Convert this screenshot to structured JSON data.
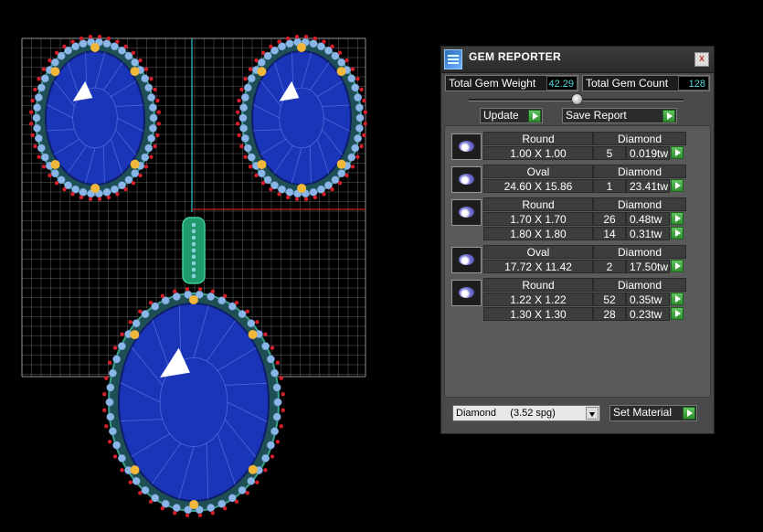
{
  "viewport": {
    "background": "#000000",
    "grid_color": "#b0b0b0",
    "gem_color": "#1a35b8",
    "prong_colors": [
      "#d21f2a",
      "#f1b73a",
      "#8bb6e8"
    ]
  },
  "panel": {
    "title": "GEM REPORTER",
    "close_label": "x",
    "total_weight_label": "Total Gem Weight",
    "total_weight_value": "42.29",
    "total_count_label": "Total Gem Count",
    "total_count_value": "128",
    "update_label": "Update",
    "save_report_label": "Save Report",
    "groups": [
      {
        "shape": "Round",
        "material": "Diamond",
        "rows": [
          {
            "size": "1.00 X 1.00",
            "count": "5",
            "weight": "0.019tw"
          }
        ]
      },
      {
        "shape": "Oval",
        "material": "Diamond",
        "rows": [
          {
            "size": "24.60 X 15.86",
            "count": "1",
            "weight": "23.41tw"
          }
        ]
      },
      {
        "shape": "Round",
        "material": "Diamond",
        "rows": [
          {
            "size": "1.70 X 1.70",
            "count": "26",
            "weight": "0.48tw"
          },
          {
            "size": "1.80 X 1.80",
            "count": "14",
            "weight": "0.31tw"
          }
        ]
      },
      {
        "shape": "Oval",
        "material": "Diamond",
        "rows": [
          {
            "size": "17.72 X 11.42",
            "count": "2",
            "weight": "17.50tw"
          }
        ]
      },
      {
        "shape": "Round",
        "material": "Diamond",
        "rows": [
          {
            "size": "1.22 X 1.22",
            "count": "52",
            "weight": "0.35tw"
          },
          {
            "size": "1.30 X 1.30",
            "count": "28",
            "weight": "0.23tw"
          }
        ]
      }
    ],
    "material_select_value": "Diamond     (3.52 spg)",
    "set_material_label": "Set Material"
  }
}
